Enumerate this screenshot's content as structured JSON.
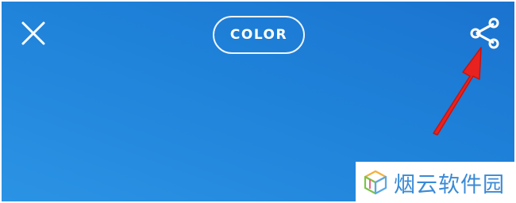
{
  "toolbar": {
    "close_icon": "close-icon",
    "mode_label": "COLOR",
    "share_icon": "share-icon"
  },
  "annotation": {
    "arrow_color": "#e8231f"
  },
  "watermark": {
    "text": "烟云软件园"
  },
  "colors": {
    "background": "#1f82d9",
    "icon": "#ffffff",
    "watermark_text": "#3a8ad6"
  }
}
